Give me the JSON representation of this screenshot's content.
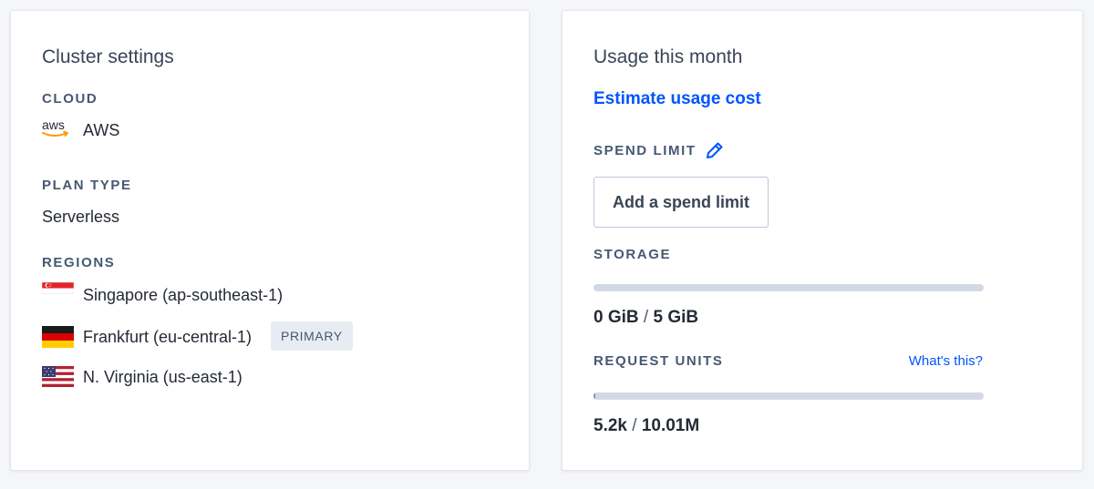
{
  "cluster_settings": {
    "title": "Cluster settings",
    "cloud": {
      "label": "CLOUD",
      "icon": "aws-logo-icon",
      "logo_text": "aws",
      "value": "AWS"
    },
    "plan_type": {
      "label": "PLAN TYPE",
      "value": "Serverless"
    },
    "regions": {
      "label": "REGIONS",
      "items": [
        {
          "name": "Singapore (ap-southeast-1)",
          "flag": "singapore-flag-icon",
          "badge": ""
        },
        {
          "name": "Frankfurt (eu-central-1)",
          "flag": "germany-flag-icon",
          "badge": "PRIMARY"
        },
        {
          "name": "N. Virginia (us-east-1)",
          "flag": "usa-flag-icon",
          "badge": ""
        }
      ]
    }
  },
  "usage": {
    "title": "Usage this month",
    "estimate_link": "Estimate usage cost",
    "spend_limit": {
      "label": "SPEND LIMIT",
      "edit_icon": "pencil-icon",
      "button_label": "Add a spend limit"
    },
    "storage": {
      "label": "STORAGE",
      "used": "0 GiB",
      "separator": "/",
      "limit": "5 GiB",
      "fraction": 0
    },
    "request_units": {
      "label": "REQUEST UNITS",
      "help_link": "What's this?",
      "used": "5.2k",
      "separator": "/",
      "limit": "10.01M",
      "fraction": 0.0005
    }
  },
  "colors": {
    "link": "#0055ff",
    "label": "#475872",
    "progress_track": "#d3d9e4",
    "badge_bg": "#e7ecf3"
  }
}
